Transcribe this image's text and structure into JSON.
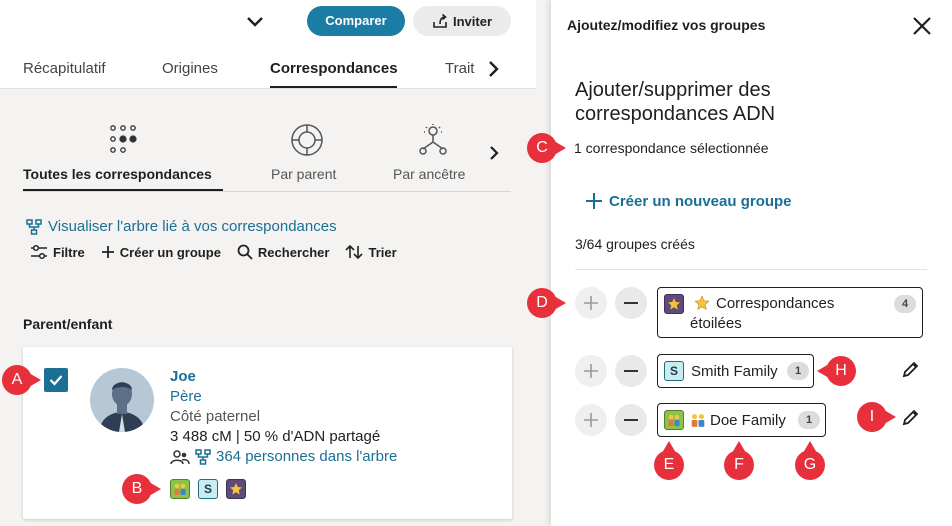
{
  "header": {
    "compare_label": "Comparer",
    "invite_label": "Inviter"
  },
  "tabs": [
    {
      "label": "Récapitulatif"
    },
    {
      "label": "Origines"
    },
    {
      "label": "Correspondances"
    },
    {
      "label": "Trait"
    }
  ],
  "subtabs": [
    {
      "label": "Toutes les correspondances"
    },
    {
      "label": "Par parent"
    },
    {
      "label": "Par ancêtre"
    }
  ],
  "tree_link": "Visualiser l'arbre lié à vos correspondances",
  "toolbar": {
    "filter": "Filtre",
    "create_group": "Créer un groupe",
    "search": "Rechercher",
    "sort": "Trier"
  },
  "section_title": "Parent/enfant",
  "match": {
    "name": "Joe",
    "relationship": "Père",
    "side": "Côté paternel",
    "dna": "3 488 cM | 50 % d'ADN partagé",
    "tree_people": "364 personnes dans l'arbre",
    "badge_s": "S"
  },
  "panel": {
    "title": "Ajoutez/modifiez vos groupes",
    "heading": "Ajouter/supprimer des correspondances ADN",
    "selected": "1 correspondance sélectionnée",
    "create_new": "Créer un nouveau groupe",
    "group_count": "3/64 groupes créés",
    "groups": [
      {
        "name": "Correspondances étoilées",
        "count": "4"
      },
      {
        "name": "Smith Family",
        "count": "1",
        "badge": "S"
      },
      {
        "name": "Doe Family",
        "count": "1"
      }
    ]
  },
  "markers": [
    "A",
    "B",
    "C",
    "D",
    "E",
    "F",
    "G",
    "H",
    "I"
  ],
  "colors": {
    "accent": "#1b7da3",
    "link": "#1b6f95",
    "marker": "#e8303c"
  }
}
